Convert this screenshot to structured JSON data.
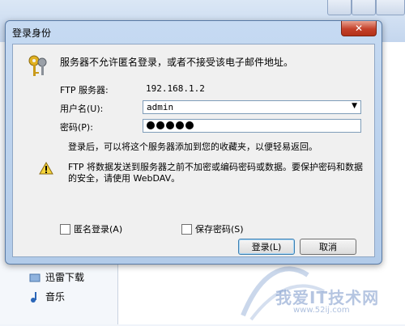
{
  "background": {
    "left_items": [
      {
        "label": "迅雷下载",
        "icon": "download-icon"
      },
      {
        "label": "音乐",
        "icon": "music-note-icon"
      }
    ],
    "watermark": {
      "text": "我爱IT技术网",
      "url": "www.52ij.com"
    }
  },
  "dialog": {
    "title": "登录身份",
    "close_label": "✕",
    "message": "服务器不允许匿名登录，或者不接受该电子邮件地址。",
    "server_label": "FTP 服务器:",
    "server_value": "192.168.1.2",
    "username_label": "用户名(U):",
    "username_value": "admin",
    "password_label": "密码(P):",
    "password_length": 5,
    "favorites_note": "登录后，可以将这个服务器添加到您的收藏夹，以便轻易返回。",
    "warning_line1": "FTP 将数据发送到服务器之前不加密或编码密码或数据。要保护密码和数据",
    "warning_line2": "的安全，请使用 WebDAV。",
    "anonymous_label": "匿名登录(A)",
    "save_password_label": "保存密码(S)",
    "login_button": "登录(L)",
    "cancel_button": "取消"
  },
  "colors": {
    "title_bar": "#b8cfea",
    "close_button": "#c4402a",
    "client_bg": "#f0f0f0"
  }
}
